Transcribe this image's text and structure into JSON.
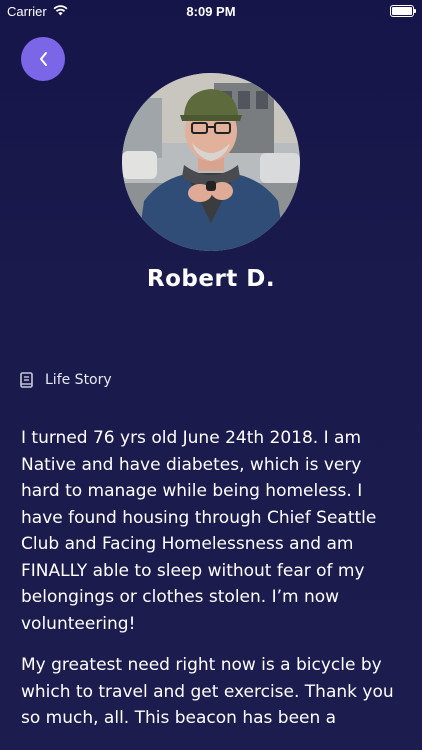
{
  "status_bar": {
    "carrier": "Carrier",
    "time": "8:09 PM",
    "wifi_icon": "wifi-icon",
    "battery_icon": "battery-icon",
    "battery_level_percent": 100
  },
  "header": {
    "back_icon": "chevron-left-icon",
    "back_button_color": "#7a66e6"
  },
  "profile": {
    "name": "Robert D.",
    "avatar": "profile-photo"
  },
  "section": {
    "icon": "book-icon",
    "label": "Life Story"
  },
  "story": {
    "paragraphs": [
      "I turned 76 yrs old June 24th 2018. I am Native and have diabetes, which is very hard to manage while being homeless. I have found housing through Chief Seattle Club and Facing Homelessness and am FINALLY able to sleep without fear of my belongings or clothes stolen. I’m now volunteering!",
      "My greatest need right now is a bicycle by which to travel and get exercise. Thank you so much, all. This beacon has been a"
    ]
  },
  "colors": {
    "background_top": "#16154a",
    "background_bottom": "#1d1c4f",
    "accent": "#7a66e6",
    "text": "#ffffff"
  }
}
